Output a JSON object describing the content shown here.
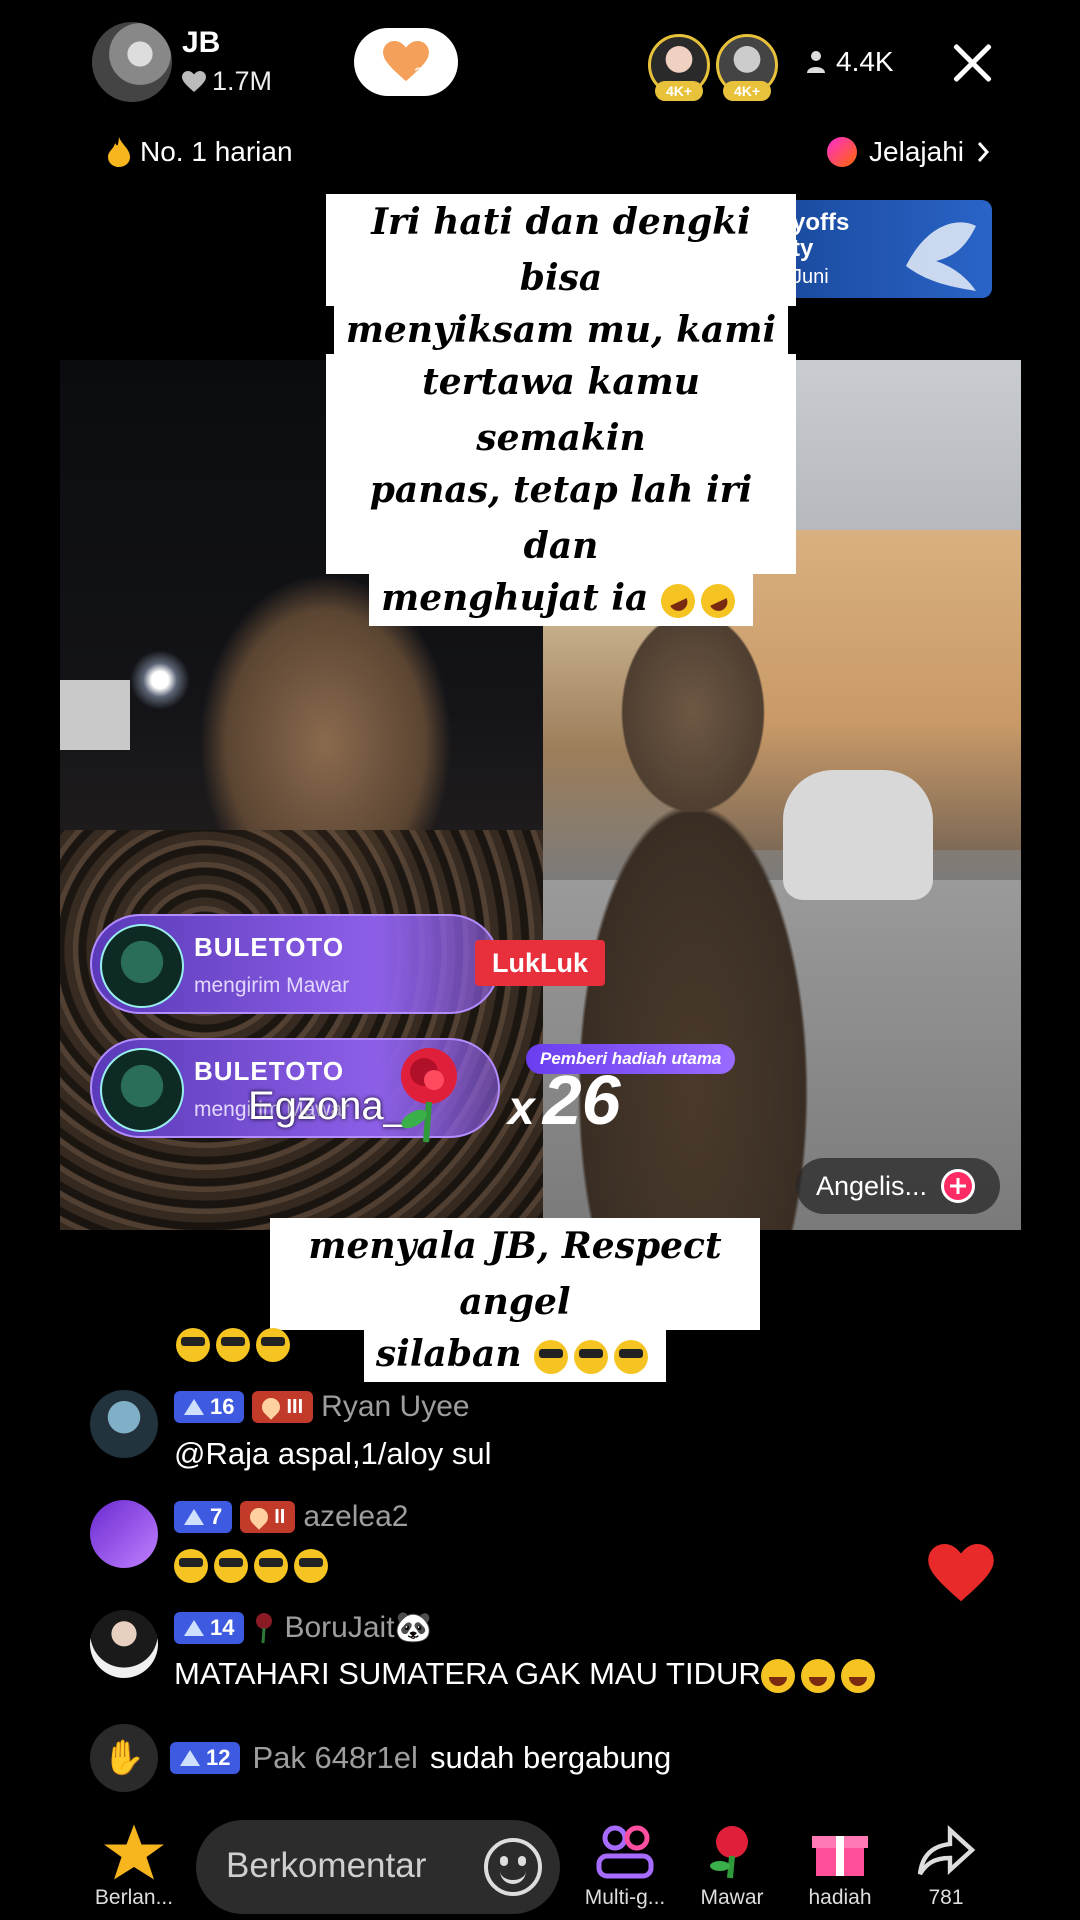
{
  "header": {
    "host_name": "JB",
    "host_likes": "1.7M",
    "follow_badge_count": "2",
    "viewer_badges": [
      "4K+",
      "4K+"
    ],
    "viewer_count": "4.4K",
    "rank_label": "No. 1 harian",
    "explore_label": "Jelajahi"
  },
  "promo_banner": {
    "title": "yoffs\nty",
    "date": "Juni"
  },
  "captions": {
    "top": [
      "Iri hati dan dengki bisa",
      "menyiksam mu, kami",
      "tertawa kamu semakin",
      "panas, tetap lah iri dan",
      "menghujat ia"
    ],
    "bottom": [
      "menyala JB, Respect angel",
      "silaban"
    ]
  },
  "gifts": {
    "banner1": {
      "name": "BULETOTO",
      "action": "mengirim Mawar"
    },
    "banner2": {
      "name": "BULETOTO",
      "action": "mengirim Mawar"
    },
    "luk_tag": "LukLuk",
    "overlay_name": "Egzona_",
    "top_gifter_label": "Pemberi hadiah utama",
    "count_prefix": "x",
    "count": "26",
    "guest_chip": "Angelis..."
  },
  "chat": [
    {
      "level": "16",
      "fan_level": "III",
      "username": "Ryan Uyee",
      "text": "@Raja aspal,1/aloy sul",
      "emojis": []
    },
    {
      "level": "7",
      "fan_level": "II",
      "username": "azelea2",
      "text": "",
      "emojis": [
        "cool",
        "cool",
        "cool",
        "cool"
      ]
    },
    {
      "level": "14",
      "fan_level": "",
      "username": "BoruJait🐼",
      "text": "MATAHARI SUMATERA GAK MAU TIDUR",
      "emojis": [
        "laugh",
        "laugh",
        "laugh"
      ]
    }
  ],
  "join_message": {
    "level": "12",
    "username": "Pak 648r1el",
    "text": "sudah bergabung"
  },
  "bottom_bar": {
    "star_label": "Berlan...",
    "comment_placeholder": "Berkomentar",
    "multi_label": "Multi-g...",
    "rose_label": "Mawar",
    "gift_label": "hadiah",
    "share_count": "781"
  },
  "colors": {
    "background": "#000000",
    "accent_red": "#e8303c",
    "level_badge": "#3e5ae0",
    "gift_banner": "#8d5fe8"
  }
}
